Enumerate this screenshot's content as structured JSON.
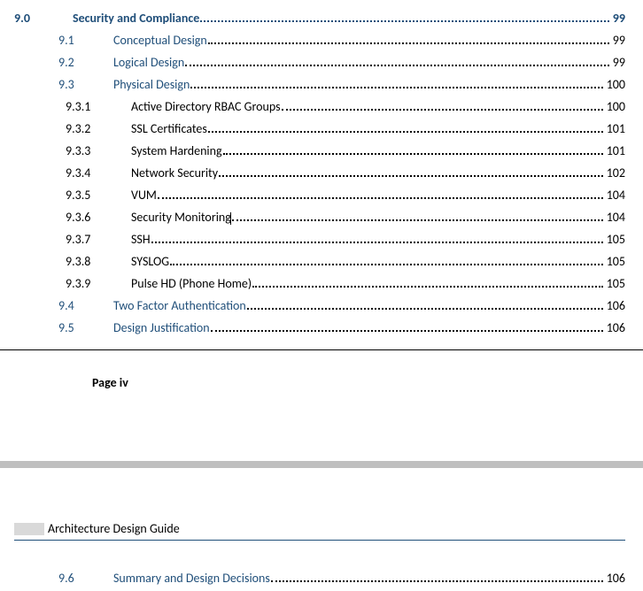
{
  "toc_page1": [
    {
      "level": 0,
      "num": "9.0",
      "title": "Security and Compliance",
      "page": "99"
    },
    {
      "level": 1,
      "num": "9.1",
      "title": "Conceptual Design",
      "page": "99"
    },
    {
      "level": 1,
      "num": "9.2",
      "title": "Logical Design",
      "page": "99"
    },
    {
      "level": 1,
      "num": "9.3",
      "title": "Physical Design",
      "page": "100"
    },
    {
      "level": 2,
      "num": "9.3.1",
      "title": "Active Directory RBAC Groups",
      "page": "100"
    },
    {
      "level": 2,
      "num": "9.3.2",
      "title": "SSL Certificates",
      "page": "101"
    },
    {
      "level": 2,
      "num": "9.3.3",
      "title": "System Hardening",
      "page": "101"
    },
    {
      "level": 2,
      "num": "9.3.4",
      "title": "Network Security",
      "page": "102"
    },
    {
      "level": 2,
      "num": "9.3.5",
      "title": "VUM",
      "page": "104"
    },
    {
      "level": 2,
      "num": "9.3.6",
      "title": "Security Monitoring",
      "page": "104",
      "cursor": true
    },
    {
      "level": 2,
      "num": "9.3.7",
      "title": "SSH",
      "page": "105"
    },
    {
      "level": 2,
      "num": "9.3.8",
      "title": "SYSLOG",
      "page": "105"
    },
    {
      "level": 2,
      "num": "9.3.9",
      "title": "Pulse HD (Phone Home)",
      "page": "105"
    },
    {
      "level": 1,
      "num": "9.4",
      "title": "Two Factor Authentication",
      "page": "106"
    },
    {
      "level": 1,
      "num": "9.5",
      "title": "Design Justification",
      "page": "106"
    }
  ],
  "page_marker": "Page iv",
  "guide_title": "Architecture Design Guide",
  "toc_page2": [
    {
      "level": 1,
      "num": "9.6",
      "title": "Summary and Design Decisions",
      "page": "106"
    }
  ]
}
